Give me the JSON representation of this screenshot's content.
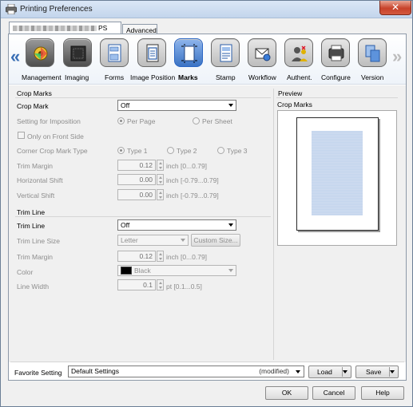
{
  "window": {
    "title": "Printing Preferences",
    "close_glyph": "✕"
  },
  "tabs": [
    {
      "label": "PS",
      "active": true
    },
    {
      "label": "Advanced",
      "active": false
    }
  ],
  "nav": {
    "prev_glyph": "«",
    "next_glyph": "»"
  },
  "categories": [
    {
      "label": "Management",
      "icon": "management-icon"
    },
    {
      "label": "Imaging",
      "icon": "imaging-icon"
    },
    {
      "label": "Forms",
      "icon": "forms-icon"
    },
    {
      "label": "Image Position",
      "icon": "image-position-icon"
    },
    {
      "label": "Marks",
      "icon": "marks-icon",
      "selected": true
    },
    {
      "label": "Stamp",
      "icon": "stamp-icon"
    },
    {
      "label": "Workflow",
      "icon": "workflow-icon"
    },
    {
      "label": "Authent.",
      "icon": "authentication-icon"
    },
    {
      "label": "Configure",
      "icon": "configure-icon"
    },
    {
      "label": "Version",
      "icon": "version-icon"
    }
  ],
  "crop_marks": {
    "group_title": "Crop Marks",
    "crop_mark_label": "Crop Mark",
    "crop_mark_value": "Off",
    "imposition_label": "Setting for Imposition",
    "per_page": "Per Page",
    "per_sheet": "Per Sheet",
    "front_side_label": "Only on Front Side",
    "mark_type_label": "Corner Crop Mark Type",
    "type1": "Type 1",
    "type2": "Type 2",
    "type3": "Type 3",
    "trim_margin_label": "Trim Margin",
    "trim_margin_value": "0.12",
    "trim_margin_range": "inch [0...0.79]",
    "h_shift_label": "Horizontal Shift",
    "h_shift_value": "0.00",
    "h_shift_range": "inch [-0.79...0.79]",
    "v_shift_label": "Vertical Shift",
    "v_shift_value": "0.00",
    "v_shift_range": "inch [-0.79...0.79]"
  },
  "trim_line": {
    "group_title": "Trim Line",
    "trim_line_label": "Trim Line",
    "trim_line_value": "Off",
    "size_label": "Trim Line Size",
    "size_value": "Letter",
    "custom_size_button": "Custom Size...",
    "margin_label": "Trim Margin",
    "margin_value": "0.12",
    "margin_range": "inch [0...0.79]",
    "color_label": "Color",
    "color_value": "Black",
    "color_swatch": "#000000",
    "width_label": "Line Width",
    "width_value": "0.1",
    "width_range": "pt [0.1...0.5]"
  },
  "preview": {
    "group_title": "Preview",
    "caption": "Crop Marks"
  },
  "favorite": {
    "label": "Favorite Setting",
    "value": "Default Settings",
    "status": "(modified)",
    "load_button": "Load",
    "save_button": "Save"
  },
  "dialog_buttons": {
    "ok": "OK",
    "cancel": "Cancel",
    "help": "Help"
  }
}
